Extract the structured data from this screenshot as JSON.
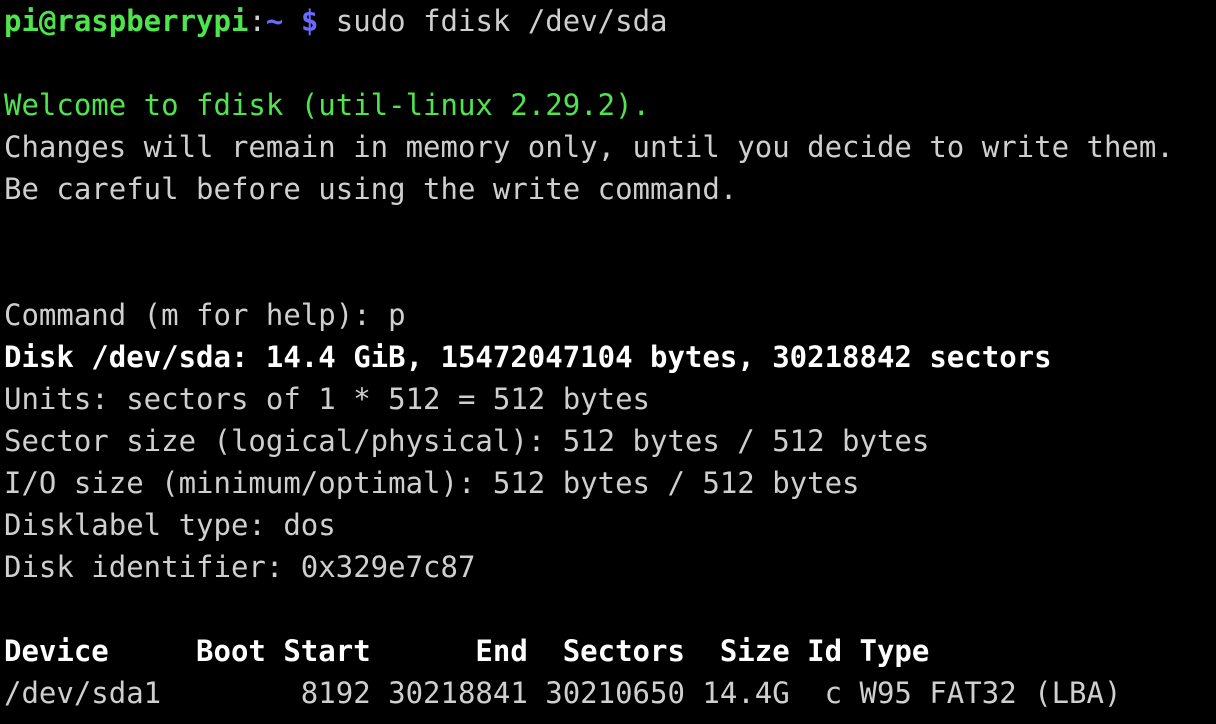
{
  "terminal": {
    "background_color": "#000000",
    "default_text_color": "#cfcfcf",
    "prompt_user_color": "#4ee44e",
    "prompt_path_color": "#6a6aff",
    "bold_text_color": "#ffffff",
    "green_text_color": "#4ee44e"
  },
  "prompt": {
    "user_host": "pi@raspberrypi",
    "separator": ":",
    "path": "~",
    "dollar": "$",
    "command": " sudo fdisk /dev/sda"
  },
  "output": {
    "welcome": "Welcome to fdisk (util-linux 2.29.2).",
    "changes_note": "Changes will remain in memory only, until you decide to write them.",
    "careful_note": "Be careful before using the write command.",
    "command_prompt": "Command (m for help): p",
    "disk_summary": "Disk /dev/sda: 14.4 GiB, 15472047104 bytes, 30218842 sectors",
    "units": "Units: sectors of 1 * 512 = 512 bytes",
    "sector_size": "Sector size (logical/physical): 512 bytes / 512 bytes",
    "io_size": "I/O size (minimum/optimal): 512 bytes / 512 bytes",
    "disklabel_type": "Disklabel type: dos",
    "disk_identifier": "Disk identifier: 0x329e7c87"
  },
  "partition_table": {
    "header": "Device     Boot Start      End  Sectors  Size Id Type",
    "rows": [
      "/dev/sda1        8192 30218841 30210650 14.4G  c W95 FAT32 (LBA)"
    ],
    "columns": [
      "Device",
      "Boot",
      "Start",
      "End",
      "Sectors",
      "Size",
      "Id",
      "Type"
    ],
    "values": [
      {
        "device": "/dev/sda1",
        "boot": "",
        "start": "8192",
        "end": "30218841",
        "sectors": "30210650",
        "size": "14.4G",
        "id": "c",
        "type": "W95 FAT32 (LBA)"
      }
    ]
  }
}
